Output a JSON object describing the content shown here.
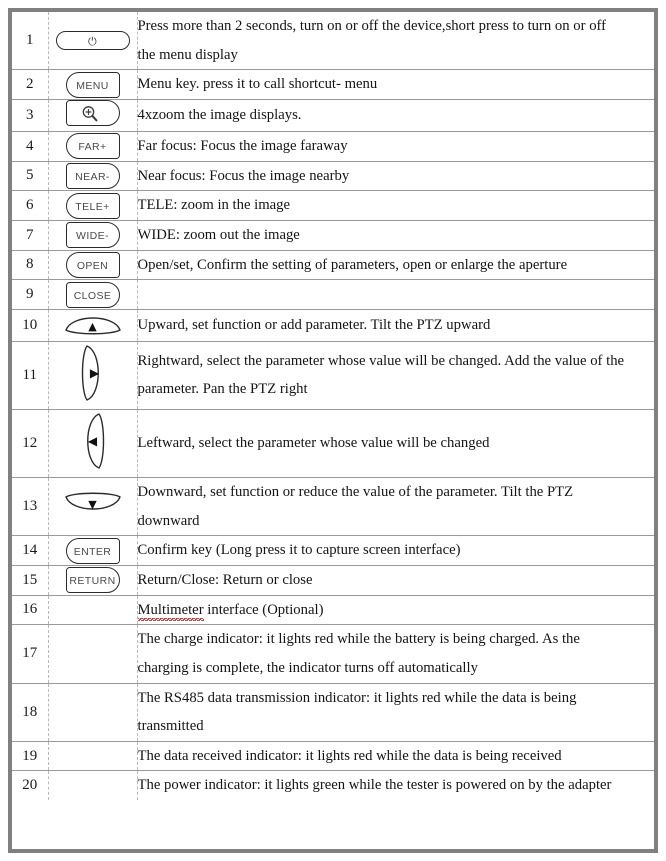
{
  "table": {
    "rows": [
      {
        "num": "1",
        "key": {
          "type": "power-key",
          "label": ""
        },
        "lines": [
          "Press more than 2 seconds, turn on or off the device,short press to turn on or off",
          "the menu display"
        ]
      },
      {
        "num": "2",
        "key": {
          "type": "cap-left",
          "label": "MENU"
        },
        "lines": [
          "Menu key. press it to call shortcut- menu"
        ]
      },
      {
        "num": "3",
        "key": {
          "type": "zoom-key",
          "label": ""
        },
        "lines": [
          "4xzoom the image displays."
        ]
      },
      {
        "num": "4",
        "key": {
          "type": "cap-left",
          "label": "FAR+"
        },
        "lines": [
          "Far focus: Focus the image faraway"
        ]
      },
      {
        "num": "5",
        "key": {
          "type": "cap-right",
          "label": "NEAR-"
        },
        "lines": [
          "Near focus: Focus the image nearby"
        ]
      },
      {
        "num": "6",
        "key": {
          "type": "cap-left",
          "label": "TELE+"
        },
        "lines": [
          "TELE: zoom in the image"
        ]
      },
      {
        "num": "7",
        "key": {
          "type": "cap-right",
          "label": "WIDE-"
        },
        "lines": [
          "WIDE: zoom out the image"
        ]
      },
      {
        "num": "8",
        "key": {
          "type": "cap-left",
          "label": "OPEN"
        },
        "lines": [
          "Open/set, Confirm the setting of parameters, open or enlarge the aperture"
        ]
      },
      {
        "num": "9",
        "key": {
          "type": "cap-right",
          "label": "CLOSE"
        },
        "lines": []
      },
      {
        "num": "10",
        "key": {
          "type": "leaf-up",
          "label": "▲"
        },
        "lines": [
          "Upward, set function or add parameter. Tilt the PTZ upward"
        ]
      },
      {
        "num": "11",
        "key": {
          "type": "leaf-right",
          "label": "▶"
        },
        "lines": [
          "Rightward, select the parameter whose value will be changed. Add the value of the",
          "parameter. Pan the PTZ right"
        ]
      },
      {
        "num": "12",
        "key": {
          "type": "leaf-left",
          "label": "◀"
        },
        "lines": [
          "Leftward, select the parameter whose value will be changed"
        ]
      },
      {
        "num": "13",
        "key": {
          "type": "leaf-down",
          "label": "▼"
        },
        "lines": [
          "Downward, set function or reduce the value of the parameter. Tilt the PTZ",
          "downward"
        ]
      },
      {
        "num": "14",
        "key": {
          "type": "cap-left",
          "label": "ENTER"
        },
        "lines": [
          "Confirm key (Long press it to capture screen interface)"
        ]
      },
      {
        "num": "15",
        "key": {
          "type": "cap-right",
          "label": "RETURN"
        },
        "lines": [
          "Return/Close: Return or close"
        ]
      },
      {
        "num": "16",
        "key": {
          "type": "none",
          "label": ""
        },
        "lines": [
          "Multimeter interface (Optional)"
        ],
        "misspelled": "Multimeter"
      },
      {
        "num": "17",
        "key": {
          "type": "none",
          "label": ""
        },
        "lines": [
          "The charge indicator: it lights red while the battery is being charged. As the",
          "charging is complete, the indicator turns off automatically"
        ]
      },
      {
        "num": "18",
        "key": {
          "type": "none",
          "label": ""
        },
        "lines": [
          "The RS485 data transmission indicator: it lights red while the data is being",
          "transmitted"
        ]
      },
      {
        "num": "19",
        "key": {
          "type": "none",
          "label": ""
        },
        "lines": [
          "The data received indicator: it lights red while the data is being received"
        ]
      },
      {
        "num": "20",
        "key": {
          "type": "none",
          "label": ""
        },
        "lines": [
          "The power indicator: it lights green while the tester is powered on by the adapter"
        ]
      }
    ]
  },
  "icons": {
    "power": "⏻",
    "magnifier_plus": "zoom-in-icon",
    "arrow_up": "▲",
    "arrow_right": "▶",
    "arrow_left": "◀",
    "arrow_down": "▼"
  },
  "colors": {
    "frame": "#808080",
    "row_divider": "#9a9a9a",
    "col_divider": "#b9b9b9",
    "key_outline": "#2b2b2b",
    "key_label": "#4a4a4a",
    "text": "#141414",
    "spellcheck": "#cc0000"
  }
}
